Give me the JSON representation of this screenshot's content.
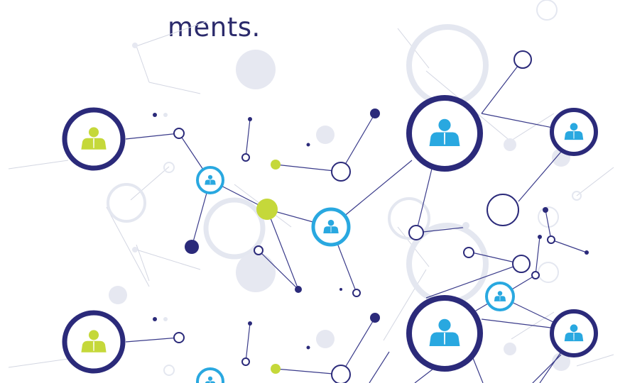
{
  "caption": {
    "text": "ments.",
    "color": "#2b2a6b"
  },
  "colors": {
    "navy": "#2b2a7a",
    "cyan": "#29a8e0",
    "lime": "#c5d83a",
    "faint_gray": "#e4e7f0",
    "faint_line": "#c9ccdb",
    "connector": "#3a3b8a"
  },
  "icons": {
    "person": "person-icon",
    "network": "network-graph"
  }
}
